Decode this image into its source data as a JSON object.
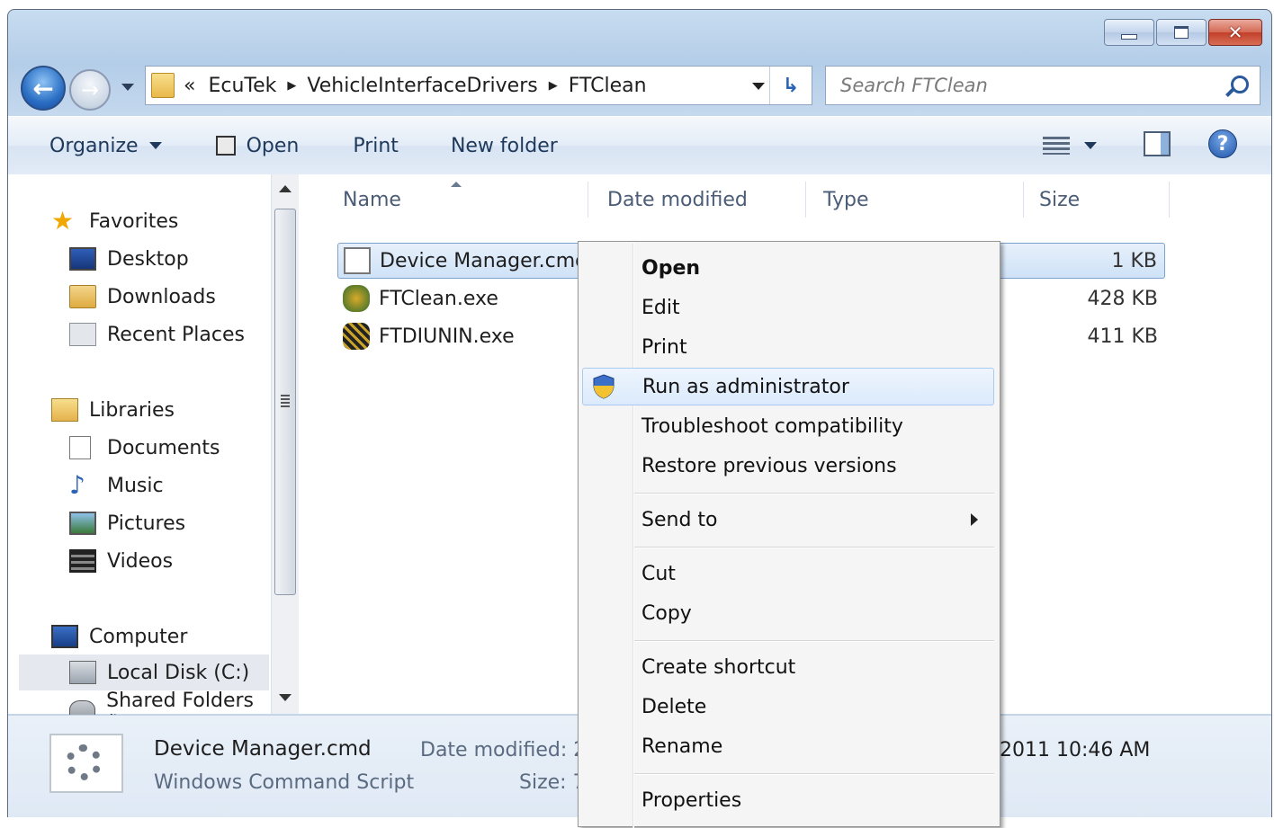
{
  "window": {
    "caption_buttons": {
      "minimize": "minimize",
      "maximize": "maximize",
      "close": "✕"
    }
  },
  "address": {
    "overflow": "«",
    "crumbs": [
      "EcuTek",
      "VehicleInterfaceDrivers",
      "FTClean"
    ],
    "refresh_glyph": "↳"
  },
  "search": {
    "placeholder": "Search FTClean",
    "value": ""
  },
  "toolbar": {
    "organize": "Organize",
    "open": "Open",
    "print": "Print",
    "new_folder": "New folder",
    "help": "?"
  },
  "nav": {
    "favorites": "Favorites",
    "desktop": "Desktop",
    "downloads": "Downloads",
    "recent_places": "Recent Places",
    "libraries": "Libraries",
    "documents": "Documents",
    "music": "Music",
    "pictures": "Pictures",
    "videos": "Videos",
    "computer": "Computer",
    "local_disk": "Local Disk (C:)",
    "shared_folders": "Shared Folders (\\"
  },
  "columns": {
    "name": "Name",
    "date_modified": "Date modified",
    "type": "Type",
    "size": "Size"
  },
  "files": [
    {
      "name": "Device Manager.cmd",
      "size": "1 KB",
      "icon": "cmd-script-icon"
    },
    {
      "name": "FTClean.exe",
      "size": "428 KB",
      "icon": "ftclean-app-icon"
    },
    {
      "name": "FTDIUNIN.exe",
      "size": "411 KB",
      "icon": "ftdiunin-app-icon"
    }
  ],
  "context_menu": {
    "open": "Open",
    "edit": "Edit",
    "print": "Print",
    "run_as_admin": "Run as administrator",
    "troubleshoot": "Troubleshoot compatibility",
    "restore": "Restore previous versions",
    "send_to": "Send to",
    "cut": "Cut",
    "copy": "Copy",
    "create_shortcut": "Create shortcut",
    "delete": "Delete",
    "rename": "Rename",
    "properties": "Properties"
  },
  "details": {
    "filename": "Device Manager.cmd",
    "filetype": "Windows Command Script",
    "date_label": "Date modified: 2",
    "size_label": "Size: 7",
    "date_tail": "2011 10:46 AM"
  },
  "colors": {
    "accent": "#3399ff",
    "selection_border": "#7da2ce",
    "frame": "#b4cde8"
  }
}
